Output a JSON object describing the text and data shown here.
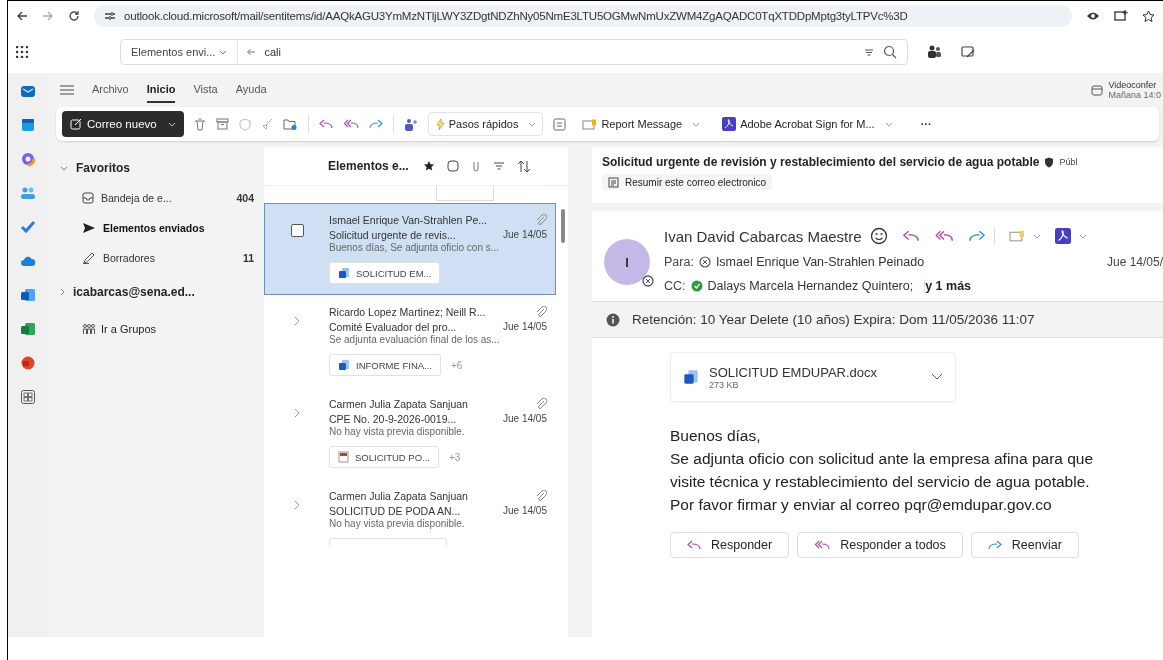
{
  "browser": {
    "url": "outlook.cloud.microsoft/mail/sentitems/id/AAQkAGU3YmMzNTljLWY3ZDgtNDZhNy05NmE3LTU5OGMwNmUxZWM4ZgAQADC0TqXTDDpMptg3tyLTPVc%3D"
  },
  "search": {
    "scope": "Elementos envi...",
    "query": "cali"
  },
  "meeting": {
    "title": "Videoconfer",
    "time": "Mañana 14:0"
  },
  "ribbon_tabs": [
    {
      "label": "Archivo",
      "selected": false
    },
    {
      "label": "Inicio",
      "selected": true
    },
    {
      "label": "Vista",
      "selected": false
    },
    {
      "label": "Ayuda",
      "selected": false
    }
  ],
  "toolbar": {
    "new_mail": "Correo nuevo",
    "quick_steps": "Pasos rápidos",
    "report": "Report Message",
    "adobe": "Adobe Acrobat Sign for M...",
    "more": "···"
  },
  "folders": {
    "favorites": "Favoritos",
    "items": [
      {
        "kind": "inbox",
        "label": "Bandeja de e...",
        "count": "404",
        "selected": false
      },
      {
        "kind": "sent",
        "label": "Elementos enviados",
        "selected": true
      },
      {
        "kind": "drafts",
        "label": "Borradores",
        "count": "11",
        "selected": false
      }
    ],
    "account": "icabarcas@sena.ed...",
    "groups": "Ir a Grupos"
  },
  "message_list": {
    "title": "Elementos e...",
    "messages": [
      {
        "from": "Ismael Enrique Van-Strahlen Pe...",
        "subject": "Solicitud urgente de revis...",
        "date": "Jue 14/05",
        "preview": "Buenos días, Se adjunta oficio con s...",
        "attachment": {
          "name": "SOLICITUD EM...",
          "kind": "word"
        },
        "selected": true
      },
      {
        "from": "Ricardo Lopez Martinez; Neill R...",
        "subject": "Comité Evaluador del pro...",
        "date": "Jue 14/05",
        "preview": "Se adjunta evaluación final de los as...",
        "attachment": {
          "name": "INFORME FINA...",
          "kind": "word"
        },
        "extra": "+6",
        "selected": false
      },
      {
        "from": "Carmen Julia Zapata Sanjuan",
        "subject": "CPE No. 20-9-2026-0019...",
        "date": "Jue 14/05",
        "preview": "No hay vista previa disponible.",
        "attachment": {
          "name": "SOLICITUD PO...",
          "kind": "pdf"
        },
        "extra": "+3",
        "selected": false
      },
      {
        "from": "Carmen Julia Zapata Sanjuan",
        "subject": "SOLICITUD DE PODA AN...",
        "date": "Jue 14/05",
        "preview": "No hay vista previa disponible.",
        "selected": false
      }
    ]
  },
  "reading": {
    "subject": "Solicitud urgente de revisión y restablecimiento del servicio de agua potable",
    "label": "Públ",
    "summarize": "Resumir este correo electronico",
    "sender": "Ivan David Cabarcas Maestre",
    "initial": "I",
    "to_label": "Para:",
    "to": "Ismael Enrique Van-Strahlen Peinado",
    "date": "Jue 14/05/",
    "cc_label": "CC:",
    "cc": "Dalays Marcela Hernandez Quintero;",
    "cc_more": "y 1 más",
    "retention": "Retención: 10 Year Delete (10 años) Expira: Dom 11/05/2036 11:07",
    "attachment": {
      "name": "SOLICITUD EMDUPAR.docx",
      "size": "273 KB"
    },
    "body": [
      "Buenos días,",
      "Se adjunta oficio con solicitud ante la empresa afina para que",
      "visite técnica y restablecimiento del servicio de agua potable.",
      "Por favor firmar y enviar al correo pqr@emdupar.gov.co"
    ],
    "actions": [
      {
        "kind": "reply",
        "label": "Responder"
      },
      {
        "kind": "reply_all",
        "label": "Responder a todos"
      },
      {
        "kind": "forward",
        "label": "Reenviar"
      }
    ]
  }
}
